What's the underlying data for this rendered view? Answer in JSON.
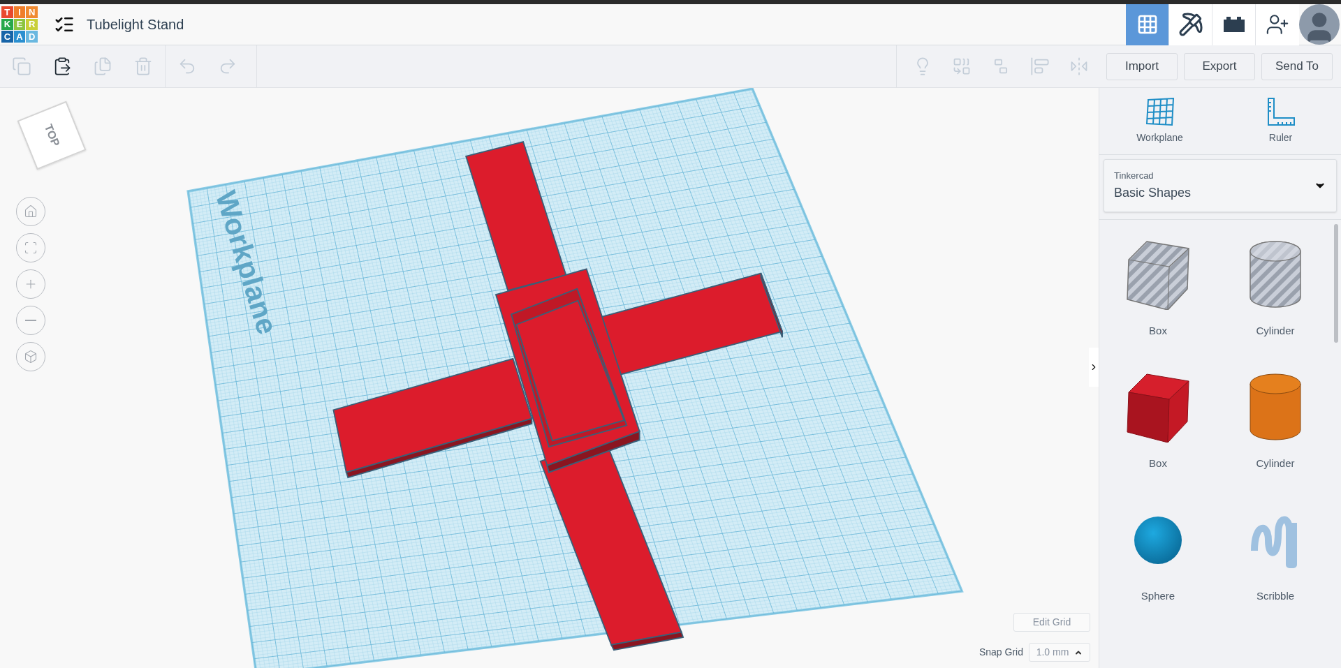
{
  "header": {
    "logo_letters": [
      {
        "text": "T",
        "color": "#e8492e"
      },
      {
        "text": "I",
        "color": "#f07e2a"
      },
      {
        "text": "N",
        "color": "#f08a30"
      },
      {
        "text": "K",
        "color": "#27a84a"
      },
      {
        "text": "E",
        "color": "#8cc43f"
      },
      {
        "text": "R",
        "color": "#c9cf38"
      },
      {
        "text": "C",
        "color": "#1764a8"
      },
      {
        "text": "A",
        "color": "#2b8fd0"
      },
      {
        "text": "D",
        "color": "#6ab8e0"
      }
    ],
    "title": "Tubelight Stand",
    "views": [
      {
        "kind": "grid",
        "selected": true
      },
      {
        "kind": "pickaxe",
        "selected": false
      },
      {
        "kind": "bricks",
        "selected": false
      }
    ]
  },
  "toolbar": {
    "tools": [
      {
        "kind": "copy",
        "disabled": true
      },
      {
        "kind": "paste",
        "disabled": false
      },
      {
        "kind": "duplicate",
        "disabled": true
      },
      {
        "kind": "delete",
        "disabled": true
      },
      {
        "kind": "undo",
        "disabled": true
      },
      {
        "kind": "redo",
        "disabled": true
      }
    ],
    "right_tools": [
      {
        "kind": "lightbulb",
        "disabled": true
      },
      {
        "kind": "group",
        "disabled": true
      },
      {
        "kind": "ungroup",
        "disabled": true
      },
      {
        "kind": "align",
        "disabled": true
      },
      {
        "kind": "mirror",
        "disabled": true
      }
    ],
    "buttons": [
      "Import",
      "Export",
      "Send To"
    ]
  },
  "viewcube": {
    "label": "TOP"
  },
  "workplane": {
    "label": "Workplane"
  },
  "grid": {
    "edit_label": "Edit Grid",
    "snap_label": "Snap Grid",
    "snap_value": "1.0 mm"
  },
  "panel": {
    "tools": [
      {
        "kind": "workplane",
        "label": "Workplane"
      },
      {
        "kind": "ruler",
        "label": "Ruler"
      }
    ],
    "library": {
      "caption": "Tinkercad",
      "value": "Basic Shapes"
    },
    "shapes": [
      {
        "kind": "box-hole",
        "label": "Box"
      },
      {
        "kind": "cylinder-hole",
        "label": "Cylinder"
      },
      {
        "kind": "box",
        "label": "Box"
      },
      {
        "kind": "cylinder",
        "label": "Cylinder"
      },
      {
        "kind": "sphere",
        "label": "Sphere"
      },
      {
        "kind": "scribble",
        "label": "Scribble"
      }
    ]
  }
}
